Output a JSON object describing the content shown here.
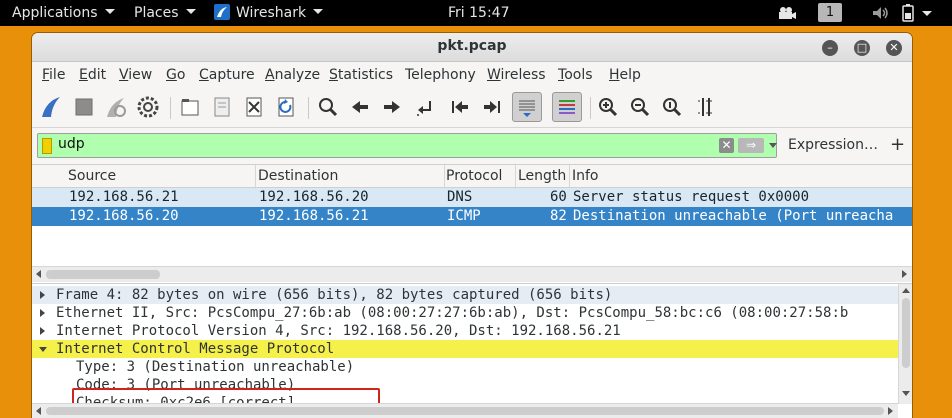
{
  "topbar": {
    "applications": "Applications",
    "places": "Places",
    "app_menu": "Wireshark",
    "clock": "Fri 15:47",
    "workspace": "1",
    "icons": [
      "video-camera-icon",
      "volume-icon",
      "battery-icon",
      "chevron-down-icon"
    ]
  },
  "window": {
    "title": "pkt.pcap",
    "controls": [
      "minimize-icon",
      "maximize-icon",
      "close-icon"
    ]
  },
  "menubar": {
    "items": [
      {
        "label": "File",
        "u": "F",
        "rest": "ile"
      },
      {
        "label": "Edit",
        "u": "E",
        "rest": "dit"
      },
      {
        "label": "View",
        "u": "V",
        "rest": "iew"
      },
      {
        "label": "Go",
        "u": "G",
        "rest": "o"
      },
      {
        "label": "Capture",
        "u": "C",
        "rest": "apture"
      },
      {
        "label": "Analyze",
        "u": "A",
        "rest": "nalyze"
      },
      {
        "label": "Statistics",
        "u": "S",
        "rest": "tatistics"
      },
      {
        "label": "Telephony",
        "u": "",
        "rest": "Telephony"
      },
      {
        "label": "Wireless",
        "u": "W",
        "rest": "ireless"
      },
      {
        "label": "Tools",
        "u": "T",
        "rest": "ools"
      },
      {
        "label": "Help",
        "u": "H",
        "rest": "elp"
      }
    ]
  },
  "toolbar": {
    "icons": [
      "shark-fin-start-icon",
      "stop-square-icon",
      "restart-fin-icon",
      "options-gear-icon",
      "open-folder-icon",
      "save-file-icon",
      "close-file-icon",
      "reload-icon",
      "find-icon",
      "back-arrow-icon",
      "forward-arrow-icon",
      "go-to-packet-icon",
      "first-packet-icon",
      "last-packet-icon",
      "autoscroll-icon",
      "colorize-icon",
      "zoom-in-icon",
      "zoom-out-icon",
      "zoom-normal-icon",
      "resize-columns-icon"
    ]
  },
  "filter": {
    "value": "udp",
    "expression_label": "Expression…",
    "plus_label": "+",
    "bg_color": "#afffaf"
  },
  "packet_list": {
    "columns": [
      "Source",
      "Destination",
      "Protocol",
      "Length",
      "Info"
    ],
    "rows": [
      {
        "source": "192.168.56.21",
        "destination": "192.168.56.20",
        "protocol": "DNS",
        "length": "60",
        "info": "Server status request 0x0000",
        "bg": "#dae8f5",
        "fg": "#12272e",
        "selected": false
      },
      {
        "source": "192.168.56.20",
        "destination": "192.168.56.21",
        "protocol": "ICMP",
        "length": "82",
        "info": "Destination unreachable (Port unreacha",
        "bg": "#3584c8",
        "fg": "#ffffff",
        "selected": true
      }
    ]
  },
  "details": {
    "rows": [
      {
        "text": "Frame 4: 82 bytes on wire (656 bits), 82 bytes captured (656 bits)",
        "expander": "collapsed",
        "bg": "#e6ecf4"
      },
      {
        "text": "Ethernet II, Src: PcsCompu_27:6b:ab (08:00:27:27:6b:ab), Dst: PcsCompu_58:bc:c6 (08:00:27:58:b",
        "expander": "collapsed",
        "bg": "#ffffff"
      },
      {
        "text": "Internet Protocol Version 4, Src: 192.168.56.20, Dst: 192.168.56.21",
        "expander": "collapsed",
        "bg": "#ffffff"
      },
      {
        "text": "Internet Control Message Protocol",
        "expander": "expanded",
        "bg": "#f5f04a"
      },
      {
        "text": "Type: 3 (Destination unreachable)",
        "expander": "none",
        "bg": "#ffffff"
      },
      {
        "text": "Code: 3 (Port unreachable)",
        "expander": "none",
        "bg": "#ffffff"
      },
      {
        "text": "Checksum: 0xc2e6 [correct]",
        "expander": "none",
        "bg": "#ffffff"
      }
    ]
  },
  "colors": {
    "desktop": "#e8900a",
    "selected_row": "#3584c8",
    "annotation_box": "#d0241b"
  }
}
